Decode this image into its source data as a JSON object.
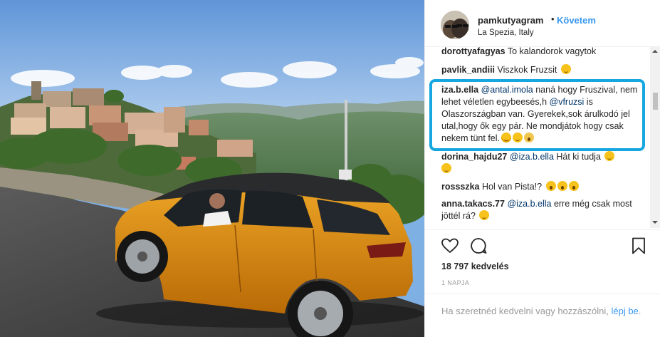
{
  "post": {
    "username": "pamkutyagram",
    "separator": "•",
    "follow_label": "Követem",
    "location": "La Spezia, Italy"
  },
  "comments": [
    {
      "author": "dorottyafagyas",
      "text": "To kalandorok vagytok"
    },
    {
      "author": "pavlik_andiii",
      "text": "Viszkok Fruzsit",
      "emoji": "wink-emoji"
    },
    {
      "author": "iza.b.ella",
      "mention1": "@antal.imola",
      "text1": " naná hogy Fruszival, nem lehet véletlen egybeesés,h ",
      "mention2": "@vfruzsi",
      "text2": " is Olaszországban van. Gyerekek,sok árulkodó jel utal,hogy ők egy pár. Ne mondjátok hogy csak nekem tünt fel.",
      "emojis": [
        "grin-sweat-emoji",
        "wink-emoji",
        "scream-emoji"
      ],
      "highlighted": true
    },
    {
      "author": "dorina_hajdu27",
      "mention": "@iza.b.ella",
      "text": " Hát ki tudja",
      "emojis": [
        "thinking-emoji",
        "hugging-emoji"
      ]
    },
    {
      "author": "rossszka",
      "text": "Hol van Pista!?",
      "emojis": [
        "open-mouth-emoji",
        "open-mouth-emoji",
        "open-mouth-emoji"
      ]
    },
    {
      "author": "anna.takacs.77",
      "mention": "@iza.b.ella",
      "text": " erre még csak most jöttél rá?",
      "emojis": [
        "thinking-emoji"
      ]
    }
  ],
  "actions": {
    "like_icon": "heart-icon",
    "comment_icon": "comment-bubble-icon",
    "save_icon": "bookmark-icon"
  },
  "likes": "18 797 kedvelés",
  "timestamp": "1 NAPJA",
  "login_prompt": {
    "text": "Ha szeretnéd kedvelni vagy hozzászólni, ",
    "link": "lépj be",
    "suffix": "."
  },
  "colors": {
    "link_blue": "#3897f0",
    "mention_blue": "#003569",
    "highlight_border": "#16a7e0",
    "car_orange": "#e8950f"
  }
}
